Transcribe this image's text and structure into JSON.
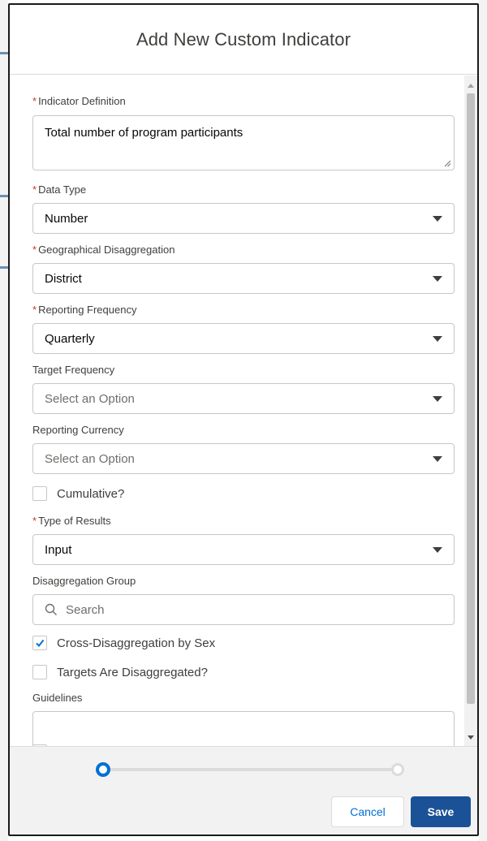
{
  "modal": {
    "title": "Add New Custom Indicator"
  },
  "form": {
    "required_marker": "*",
    "indicator_definition": {
      "label": "Indicator Definition",
      "value": "Total number of program participants"
    },
    "data_type": {
      "label": "Data Type",
      "value": "Number"
    },
    "geo_disaggregation": {
      "label": "Geographical Disaggregation",
      "value": "District"
    },
    "reporting_frequency": {
      "label": "Reporting Frequency",
      "value": "Quarterly"
    },
    "target_frequency": {
      "label": "Target Frequency",
      "placeholder": "Select an Option"
    },
    "reporting_currency": {
      "label": "Reporting Currency",
      "placeholder": "Select an Option"
    },
    "cumulative": {
      "label": "Cumulative?",
      "checked": false
    },
    "type_of_results": {
      "label": "Type of Results",
      "value": "Input"
    },
    "disaggregation_group": {
      "label": "Disaggregation Group",
      "placeholder": "Search"
    },
    "cross_disaggregation_sex": {
      "label": "Cross-Disaggregation by Sex",
      "checked": true
    },
    "targets_disaggregated": {
      "label": "Targets Are Disaggregated?",
      "checked": false
    },
    "guidelines": {
      "label": "Guidelines",
      "value": ""
    }
  },
  "footer": {
    "progress": {
      "current_step": 1,
      "total_steps": 2
    },
    "cancel_label": "Cancel",
    "save_label": "Save"
  },
  "colors": {
    "brand_blue": "#0070d2",
    "save_blue": "#1b5297",
    "required_red": "#c23934"
  },
  "icons": [
    "search-icon",
    "checkmark-icon",
    "dropdown-caret-icon",
    "resize-grip-icon"
  ]
}
